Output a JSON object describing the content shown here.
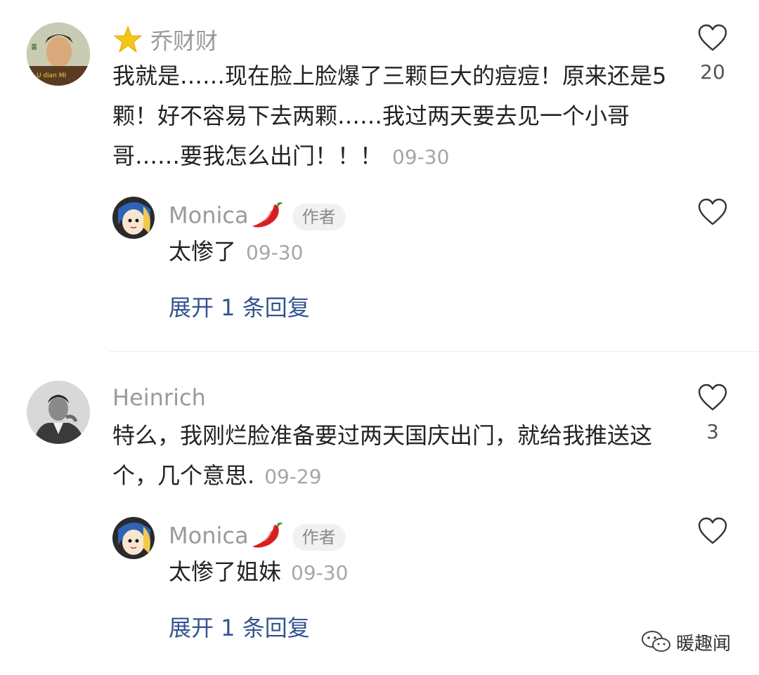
{
  "comments": [
    {
      "author": "乔财财",
      "badge_icon": "star-emoji-icon",
      "text": "我就是……现在脸上脸爆了三颗巨大的痘痘！原来还是5颗！好不容易下去两颗……我过两天要去见一个小哥哥……要我怎么出门！！！",
      "date": "09-30",
      "likes": "20",
      "reply": {
        "author": "Monica",
        "author_emoji": "chili-pepper-icon",
        "badge": "作者",
        "text": "太惨了",
        "date": "09-30"
      },
      "expand_label": "展开 1 条回复"
    },
    {
      "author": "Heinrich",
      "text": "特么，我刚烂脸准备要过两天国庆出门，就给我推送这个，几个意思.",
      "date": "09-29",
      "likes": "3",
      "reply": {
        "author": "Monica",
        "author_emoji": "chili-pepper-icon",
        "badge": "作者",
        "text": "太惨了姐妹",
        "date": "09-30"
      },
      "expand_label": "展开 1 条回复"
    }
  ],
  "watermark": "暖趣闻",
  "colors": {
    "link": "#34548f",
    "muted": "#9a9a9a",
    "divider": "#ececec"
  }
}
